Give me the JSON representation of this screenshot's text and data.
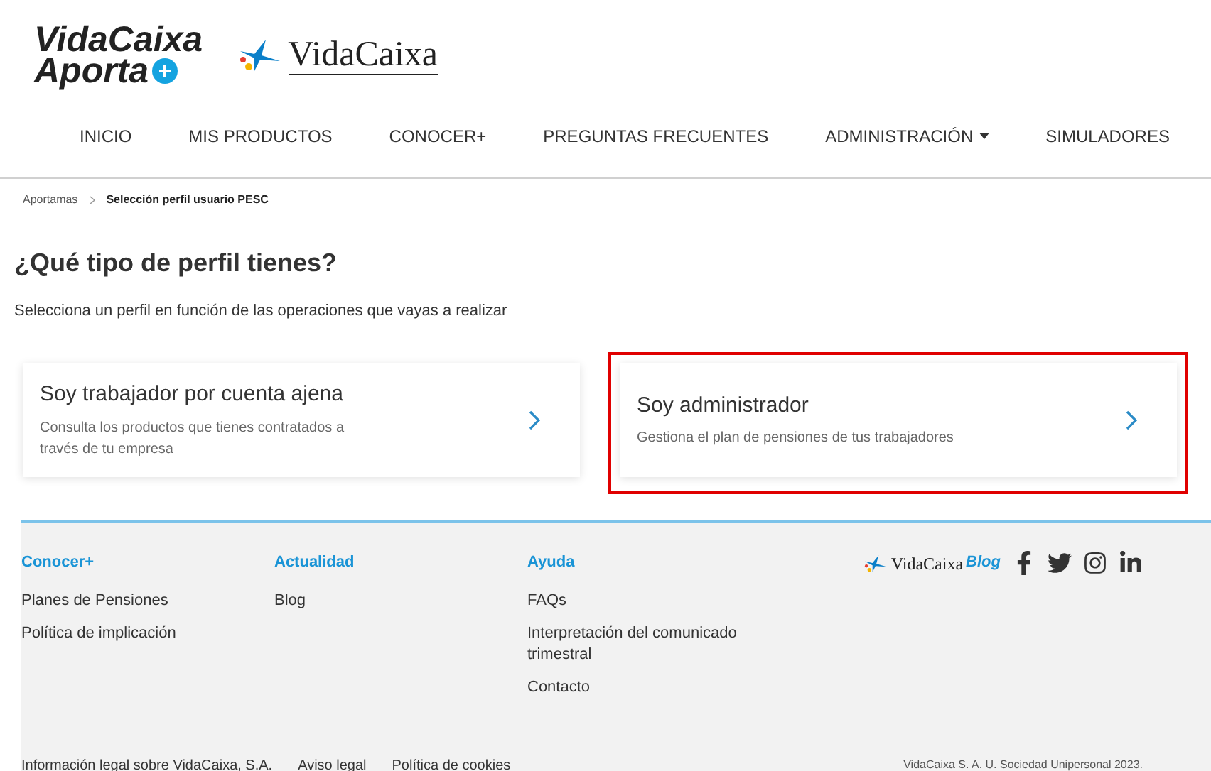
{
  "logo": {
    "line_1": "VidaCaixa",
    "line_2": "Aporta",
    "partner": "VidaCaixa"
  },
  "nav": [
    {
      "label": "INICIO",
      "dropdown": false
    },
    {
      "label": "MIS PRODUCTOS",
      "dropdown": false
    },
    {
      "label": "CONOCER+",
      "dropdown": false
    },
    {
      "label": "PREGUNTAS FRECUENTES",
      "dropdown": false
    },
    {
      "label": "ADMINISTRACIÓN",
      "dropdown": true
    },
    {
      "label": "SIMULADORES",
      "dropdown": false
    }
  ],
  "breadcrumb": [
    {
      "label": "Aportamas",
      "current": false
    },
    {
      "label": "Selección perfil usuario PESC",
      "current": true
    }
  ],
  "heading": "¿Qué tipo de perfil tienes?",
  "subheading": "Selecciona un perfil en función de las operaciones que vayas a realizar",
  "profiles": [
    {
      "title": "Soy trabajador por cuenta ajena",
      "description": "Consulta los productos que tienes contratados a través de tu empresa",
      "highlighted": false
    },
    {
      "title": "Soy administrador",
      "description": "Gestiona el plan de pensiones de tus trabajadores",
      "highlighted": true
    }
  ],
  "footer": {
    "columns": [
      {
        "title": "Conocer+",
        "links": [
          "Planes de Pensiones",
          "Política de implicación"
        ]
      },
      {
        "title": "Actualidad",
        "links": [
          "Blog"
        ]
      },
      {
        "title": "Ayuda",
        "links": [
          "FAQs",
          "Interpretación del comunicado trimestral",
          "Contacto"
        ]
      }
    ],
    "blog_logo": {
      "brand": "VidaCaixa",
      "suffix": "Blog"
    },
    "legal_links": [
      "Información legal sobre VidaCaixa, S.A.",
      "Aviso legal",
      "Política de cookies"
    ],
    "copyright": "VidaCaixa S. A. U. Sociedad Unipersonal 2023."
  }
}
